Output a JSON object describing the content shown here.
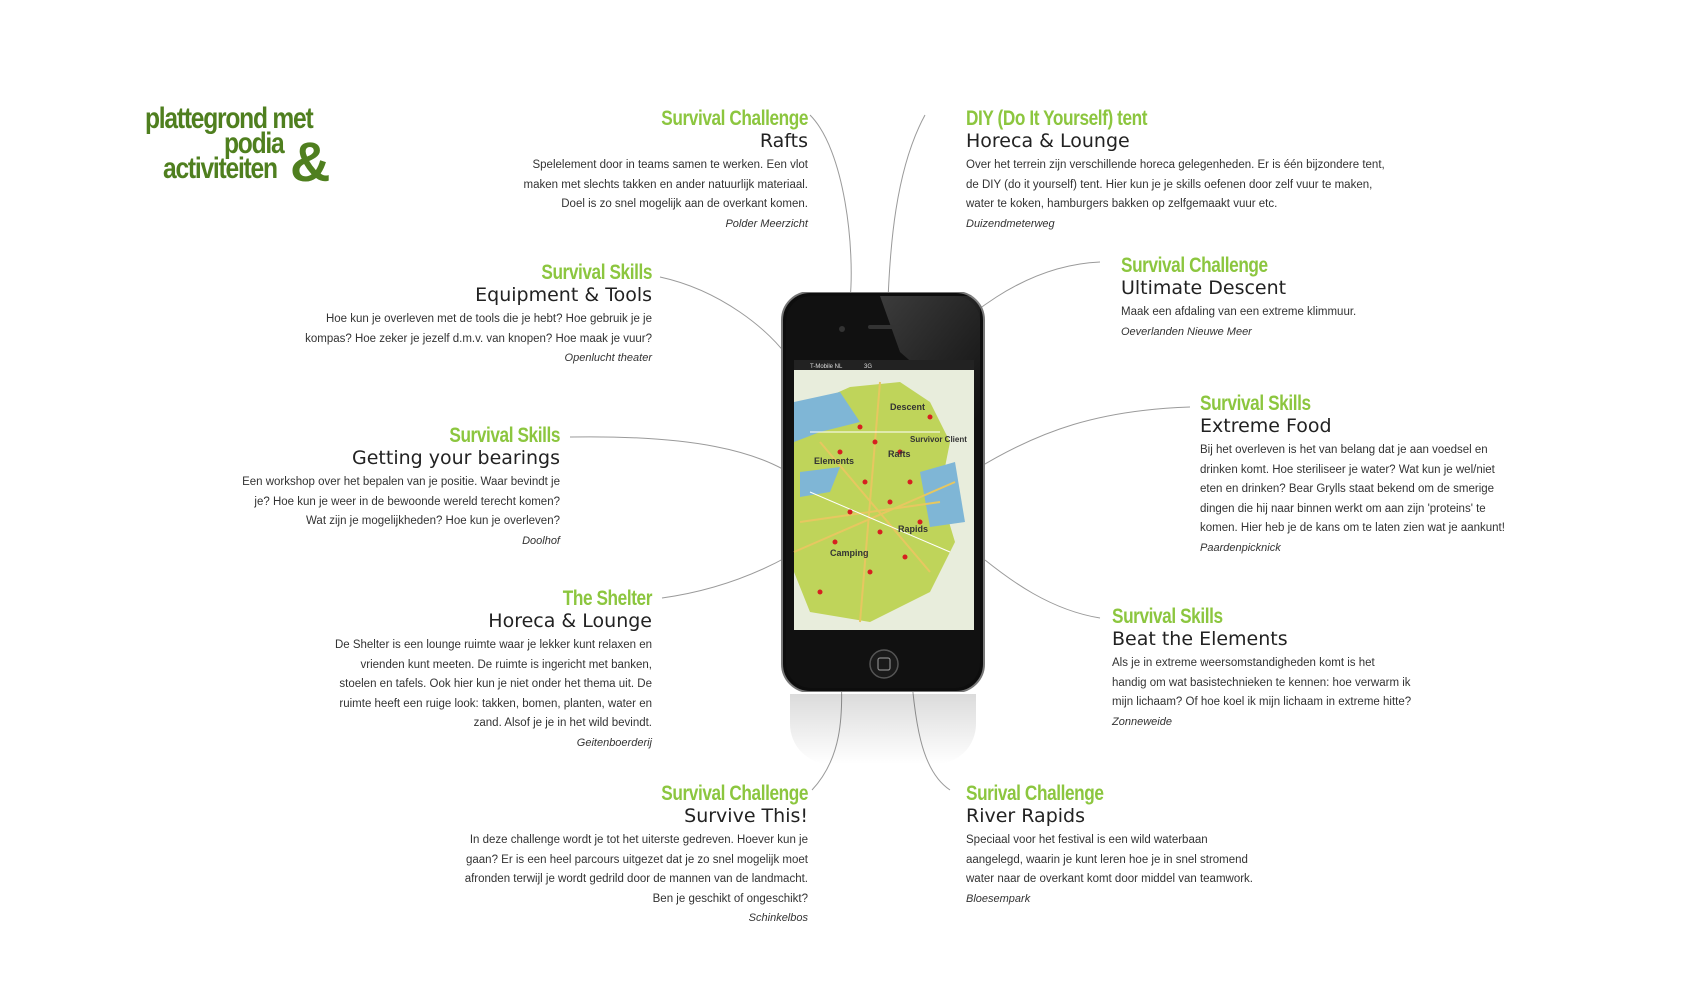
{
  "logo": {
    "line1": "plattegrond met",
    "line2": "podia",
    "line3": "activiteiten",
    "amp": "&"
  },
  "colors": {
    "accent_green": "#8cc63f",
    "logo_green": "#4f7f1f",
    "text": "#333333"
  },
  "phone": {
    "carrier": "T-Mobile NL",
    "network": "3G",
    "map_labels": [
      "Descent",
      "Survivor Client",
      "Elements",
      "Rafts",
      "Rapids",
      "Camping"
    ]
  },
  "activities": [
    {
      "title": "Survival Challenge",
      "subtitle": "Rafts",
      "description": "Spelelement door in teams samen te werken. Een vlot maken met slechts takken en ander natuurlijk materiaal. Doel is zo snel mogelijk aan de overkant komen.",
      "location": "Polder Meerzicht"
    },
    {
      "title": "DIY (Do It Yourself) tent",
      "subtitle": "Horeca & Lounge",
      "description": "Over het terrein zijn verschillende horeca gelegenheden. Er is één bijzondere tent, de DIY (do it yourself) tent. Hier kun je je skills oefenen door zelf vuur te maken, water te koken, hamburgers bakken op zelfgemaakt vuur etc.",
      "location": "Duizendmeterweg"
    },
    {
      "title": "Survival Skills",
      "subtitle": "Equipment & Tools",
      "description": "Hoe kun je overleven met de tools die je hebt? Hoe gebruik je je kompas? Hoe zeker je jezelf d.m.v. van knopen? Hoe maak je vuur?",
      "location": "Openlucht theater"
    },
    {
      "title": "Survival Challenge",
      "subtitle": "Ultimate Descent",
      "description": "Maak een afdaling van een extreme klimmuur.",
      "location": "Oeverlanden Nieuwe Meer"
    },
    {
      "title": "Survival Skills",
      "subtitle": "Getting your bearings",
      "description": "Een workshop over het bepalen van je positie. Waar bevindt je je? Hoe kun je weer in de bewoonde wereld terecht komen? Wat zijn je mogelijkheden? Hoe kun je overleven?",
      "location": "Doolhof"
    },
    {
      "title": "Survival Skills",
      "subtitle": "Extreme Food",
      "description": "Bij het overleven is het van belang dat je aan voedsel en drinken komt. Hoe steriliseer je water? Wat kun je wel/niet eten en drinken? Bear Grylls staat bekend om de smerige dingen die hij naar binnen werkt om aan zijn 'proteins' te komen. Hier heb je de kans om te laten zien wat je aankunt!",
      "location": "Paardenpicknick"
    },
    {
      "title": "The Shelter",
      "subtitle": "Horeca & Lounge",
      "description": "De Shelter is een lounge ruimte waar je lekker kunt relaxen en vrienden kunt meeten. De ruimte is ingericht met banken, stoelen en tafels. Ook hier kun je niet onder het thema uit. De ruimte heeft een ruige look: takken, bomen, planten, water en zand. Alsof je je in het wild bevindt.",
      "location": "Geitenboerderij"
    },
    {
      "title": "Survival Skills",
      "subtitle": "Beat the Elements",
      "description": "Als je in extreme weersomstandigheden komt is het handig om wat basistechnieken te kennen: hoe verwarm ik mijn lichaam? Of hoe koel ik mijn lichaam in extreme hitte?",
      "location": "Zonneweide"
    },
    {
      "title": "Survival Challenge",
      "subtitle": "Survive This!",
      "description": "In deze challenge wordt je tot het uiterste gedreven. Hoever kun je gaan? Er is een heel parcours uitgezet dat je zo snel mogelijk moet afronden terwijl je wordt gedrild door de mannen van de landmacht. Ben je geschikt of ongeschikt?",
      "location": "Schinkelbos"
    },
    {
      "title": "Surival Challenge",
      "subtitle": "River Rapids",
      "description": "Speciaal voor het festival is een wild waterbaan aangelegd, waarin je kunt leren hoe je in snel stromend water naar de overkant komt door middel van teamwork.",
      "location": "Bloesempark"
    }
  ]
}
